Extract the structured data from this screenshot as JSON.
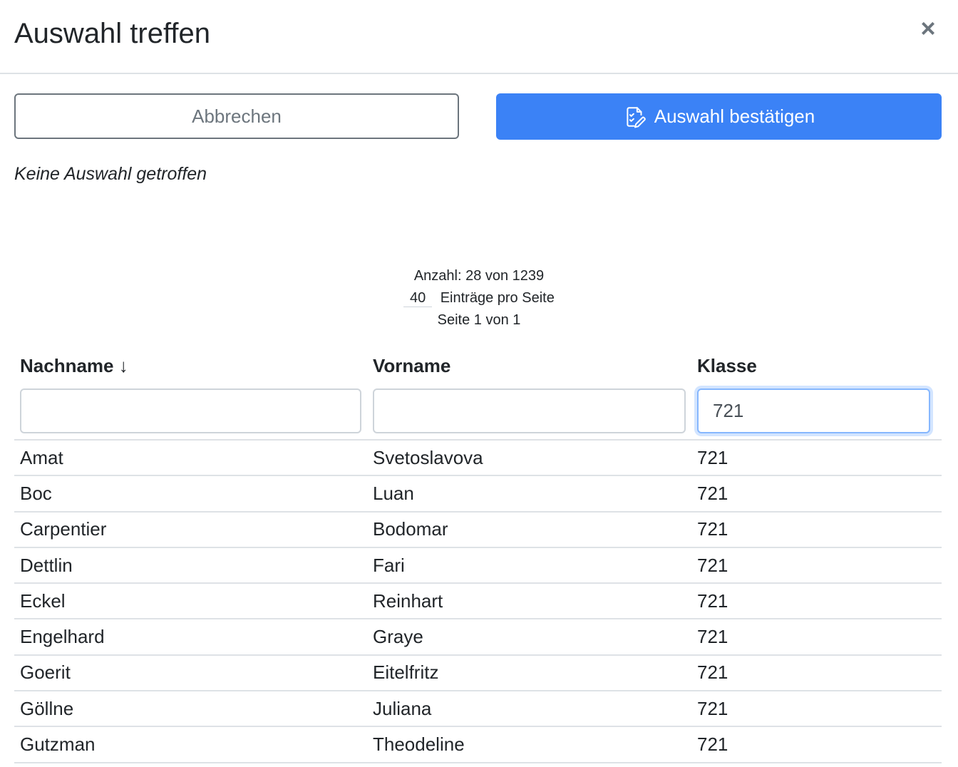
{
  "dialog": {
    "title": "Auswahl treffen",
    "close_symbol": "×"
  },
  "actions": {
    "cancel_label": "Abbrechen",
    "confirm_label": "Auswahl bestätigen",
    "confirm_icon": "checklist-edit-icon",
    "accent_color": "#3b82f6"
  },
  "selection_status": "Keine Auswahl getroffen",
  "pager": {
    "count_text": "Anzahl: 28 von 1239",
    "per_page_value": "40",
    "per_page_label": "Einträge pro Seite",
    "page_text": "Seite 1 von 1"
  },
  "table": {
    "columns": [
      {
        "label": "Nachname ↓"
      },
      {
        "label": "Vorname"
      },
      {
        "label": "Klasse"
      }
    ],
    "filters": [
      "",
      "",
      "721"
    ],
    "rows": [
      [
        "Amat",
        "Svetoslavova",
        "721"
      ],
      [
        "Boc",
        "Luan",
        "721"
      ],
      [
        "Carpentier",
        "Bodomar",
        "721"
      ],
      [
        "Dettlin",
        "Fari",
        "721"
      ],
      [
        "Eckel",
        "Reinhart",
        "721"
      ],
      [
        "Engelhard",
        "Graye",
        "721"
      ],
      [
        "Goerit",
        "Eitelfritz",
        "721"
      ],
      [
        "Göllne",
        "Juliana",
        "721"
      ],
      [
        "Gutzman",
        "Theodeline",
        "721"
      ]
    ]
  }
}
